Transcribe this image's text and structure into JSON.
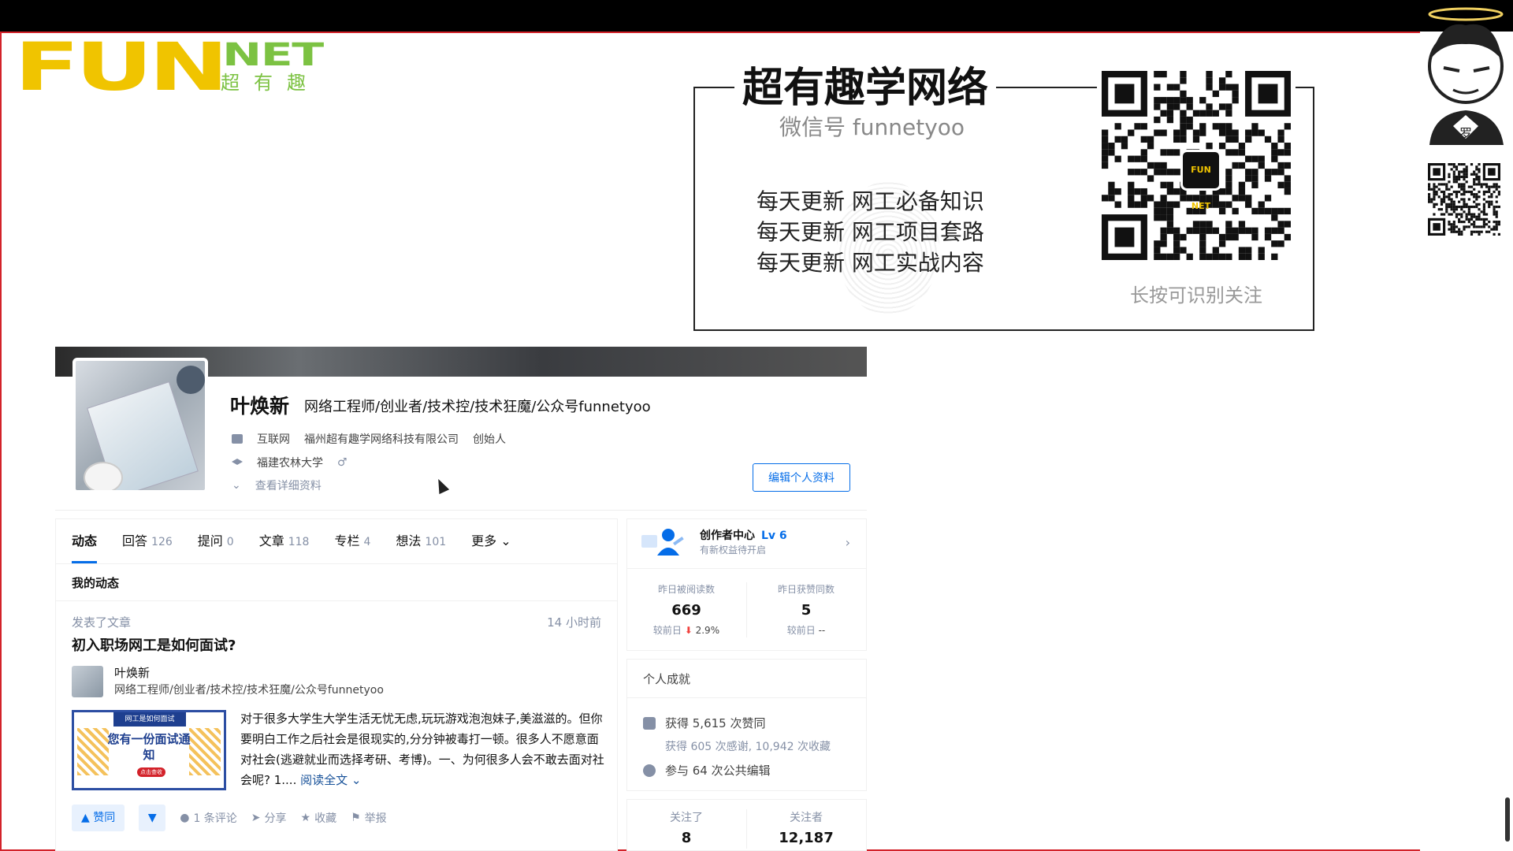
{
  "logo": {
    "fun": "FUN",
    "net": "NET",
    "cn": "超有趣"
  },
  "banner": {
    "title": "超有趣学网络",
    "wechat": "微信号 funnetyoo",
    "lines": [
      "每天更新 网工必备知识",
      "每天更新 网工项目套路",
      "每天更新 网工实战内容"
    ],
    "hint": "长按可识别关注",
    "qr_center": "FUN NET"
  },
  "side": {
    "avatar_char": "罗"
  },
  "profile": {
    "name": "叶焕新",
    "headline": "网络工程师/创业者/技术控/技术狂魔/公众号funnetyoo",
    "industry": "互联网",
    "company": "福州超有趣学网络科技有限公司",
    "position": "创始人",
    "school": "福建农林大学",
    "gender_icon": "♂",
    "details_link": "查看详细资料",
    "edit_button": "编辑个人资料"
  },
  "tabs": [
    {
      "label": "动态",
      "count": ""
    },
    {
      "label": "回答",
      "count": "126"
    },
    {
      "label": "提问",
      "count": "0"
    },
    {
      "label": "文章",
      "count": "118"
    },
    {
      "label": "专栏",
      "count": "4"
    },
    {
      "label": "想法",
      "count": "101"
    },
    {
      "label": "更多",
      "count": ""
    }
  ],
  "feed": {
    "section_title": "我的动态",
    "action_type": "发表了文章",
    "time": "14 小时前",
    "article_title": "初入职场网工是如何面试?",
    "author_name": "叶焕新",
    "author_headline": "网络工程师/创业者/技术控/技术狂魔/公众号funnetyoo",
    "thumb": {
      "ribbon": "网工是如何面试",
      "big": "您有一份面试通知",
      "tag": "点击查收"
    },
    "excerpt": "对于很多大学生大学生活无忧无虑,玩玩游戏泡泡妹子,美滋滋的。但你要明白工作之后社会是很现实的,分分钟被毒打一顿。很多人不愿意面对社会(逃避就业而选择考研、考博)。一、为何很多人会不敢去面对社会呢? 1....",
    "read_more": "阅读全文",
    "vote": "▲ 赞同",
    "comments": "1 条评论",
    "share": "分享",
    "collect": "收藏",
    "report": "举报"
  },
  "creator": {
    "title": "创作者中心",
    "level": "Lv 6",
    "subtitle": "有新权益待开启",
    "read_label": "昨日被阅读数",
    "read_value": "669",
    "read_compare_label": "较前日",
    "read_compare_value": "2.9%",
    "like_label": "昨日获赞同数",
    "like_value": "5",
    "like_compare_label": "较前日",
    "like_compare_value": "--"
  },
  "achievement": {
    "title": "个人成就",
    "likes": "获得 5,615 次赞同",
    "thanks": "获得 605 次感谢, 10,942 次收藏",
    "edits": "参与 64 次公共编辑"
  },
  "follow": {
    "following_label": "关注了",
    "following_value": "8",
    "followers_label": "关注者",
    "followers_value": "12,187"
  }
}
